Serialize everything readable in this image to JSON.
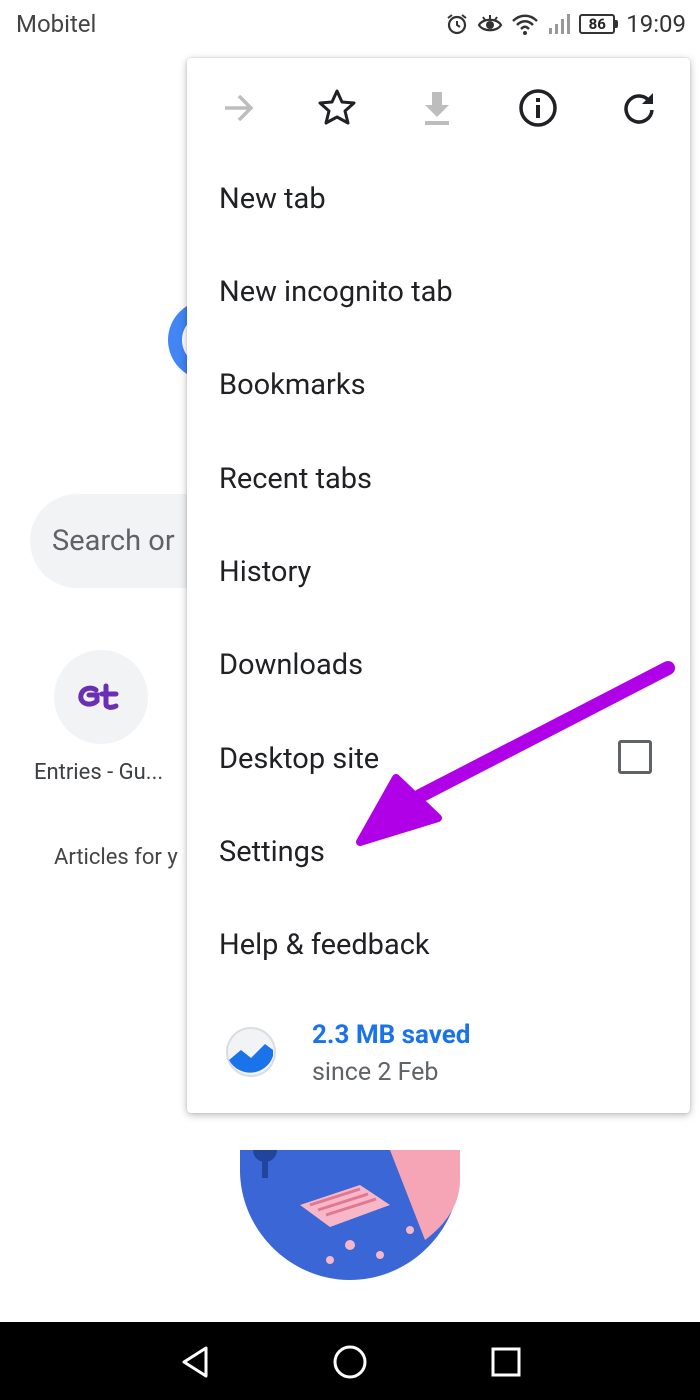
{
  "status_bar": {
    "carrier": "Mobitel",
    "battery": "86",
    "time": "19:09",
    "icons": [
      "alarm-icon",
      "eye-comfort-icon",
      "wifi-icon",
      "signal-icon",
      "battery-icon"
    ]
  },
  "background": {
    "search_placeholder": "Search or",
    "shortcut_label": "Entries - Gu...",
    "shortcut_icon_text": "Gt",
    "articles_label": "Articles for y"
  },
  "menu": {
    "toolbar": [
      {
        "name": "forward-icon",
        "enabled": false
      },
      {
        "name": "star-icon",
        "enabled": true
      },
      {
        "name": "download-icon",
        "enabled": false
      },
      {
        "name": "info-icon",
        "enabled": true
      },
      {
        "name": "refresh-icon",
        "enabled": true
      }
    ],
    "items": [
      {
        "label": "New tab"
      },
      {
        "label": "New incognito tab"
      },
      {
        "label": "Bookmarks"
      },
      {
        "label": "Recent tabs"
      },
      {
        "label": "History"
      },
      {
        "label": "Downloads"
      },
      {
        "label": "Desktop site",
        "checked": false
      },
      {
        "label": "Settings"
      },
      {
        "label": "Help & feedback"
      }
    ],
    "data_saver": {
      "amount": "2.3 MB saved",
      "since": "since 2 Feb"
    }
  },
  "colors": {
    "accent_blue": "#1a73e8",
    "annotation_arrow": "#b000e8",
    "logo_purple": "#6b2fb3"
  },
  "nav_bar": {
    "buttons": [
      "back-icon",
      "home-icon",
      "recents-icon"
    ]
  }
}
